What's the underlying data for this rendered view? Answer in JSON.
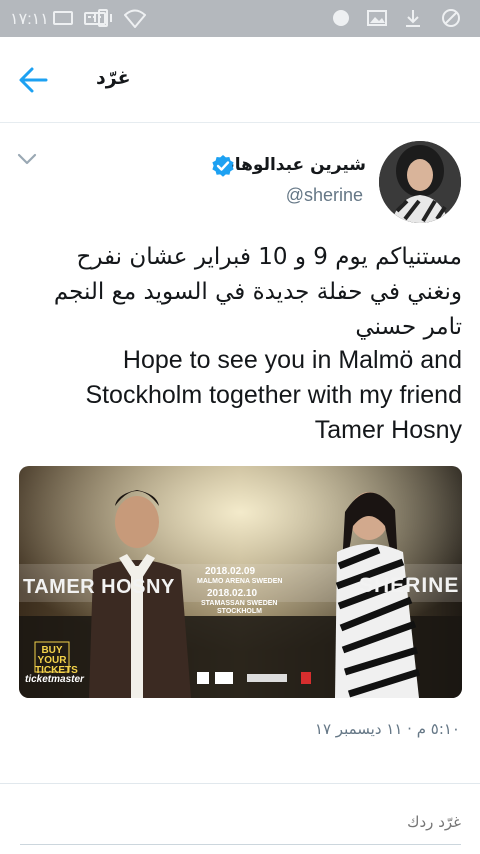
{
  "statusbar": {
    "time": "١٧:١١",
    "icons": [
      "messages-icon",
      "keyboard-icon",
      "vibrate-icon",
      "wifi-icon",
      "notification-icon",
      "image-icon",
      "download-icon",
      "blocked-icon"
    ]
  },
  "header": {
    "title": "غرّد",
    "back_icon": "arrow-left-icon"
  },
  "tweet": {
    "display_name": "شيرين عبدالوهاب",
    "handle": "@sherine",
    "verified": true,
    "text_arabic": "مستنياكم يوم 9 و 10 فبراير عشان نفرح ونغني في حفلة جديدة في السويد مع النجم تامر حسني",
    "text_english": "Hope to see you in Malmö and Stockholm together with my friend Tamer Hosny",
    "media": {
      "left_name": "TAMER HOSNY",
      "right_name": "SHERINE",
      "date1": "2018.02.09",
      "venue1": "MALMO ARENA SWEDEN",
      "date2": "2018.02.10",
      "venue2": "STAMASSAN SWEDEN",
      "city2": "STOCKHOLM",
      "buy_label": "BUY YOUR TICKETS",
      "ticket_brand": "ticketmaster"
    },
    "timestamp": "٥:١٠ م · ١١ ديسمبر ١٧"
  },
  "reply": {
    "placeholder": "غرّد ردك"
  },
  "colors": {
    "statusbar": "#b4b8bd",
    "accent": "#1da1f2",
    "secondary_text": "#657786"
  }
}
